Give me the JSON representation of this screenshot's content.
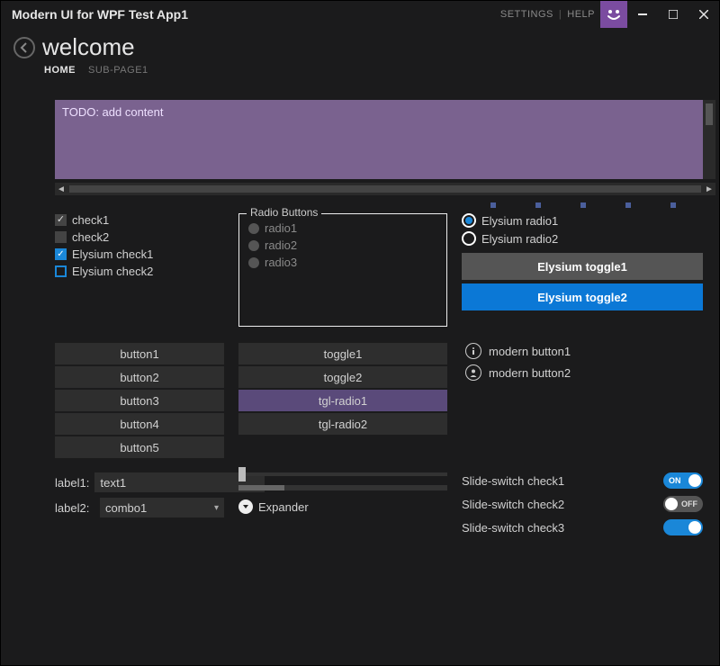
{
  "titlebar": {
    "title": "Modern UI for WPF Test App1",
    "settings": "SETTINGS",
    "help": "HELP"
  },
  "header": {
    "page_title": "welcome",
    "tabs": {
      "home": "HOME",
      "sub": "SUB-PAGE1"
    }
  },
  "todo_text": "TODO: add content",
  "checks": {
    "c1": "check1",
    "c2": "check2",
    "e1": "Elysium check1",
    "e2": "Elysium check2"
  },
  "radiogroup": {
    "legend": "Radio Buttons",
    "r1": "radio1",
    "r2": "radio2",
    "r3": "radio3"
  },
  "eradios": {
    "r1": "Elysium radio1",
    "r2": "Elysium radio2"
  },
  "etoggles": {
    "t1": "Elysium toggle1",
    "t2": "Elysium toggle2"
  },
  "buttons": {
    "b1": "button1",
    "b2": "button2",
    "b3": "button3",
    "b4": "button4",
    "b5": "button5"
  },
  "toggles": {
    "t1": "toggle1",
    "t2": "toggle2",
    "tr1": "tgl-radio1",
    "tr2": "tgl-radio2"
  },
  "modern_buttons": {
    "m1": "modern button1",
    "m2": "modern button2"
  },
  "form": {
    "label1": "label1:",
    "label2": "label2:",
    "text1_value": "text1",
    "combo1_value": "combo1"
  },
  "expander_label": "Expander",
  "switches": {
    "s1": "Slide-switch check1",
    "s2": "Slide-switch check2",
    "s3": "Slide-switch check3",
    "on_text": "ON",
    "off_text": "OFF"
  }
}
